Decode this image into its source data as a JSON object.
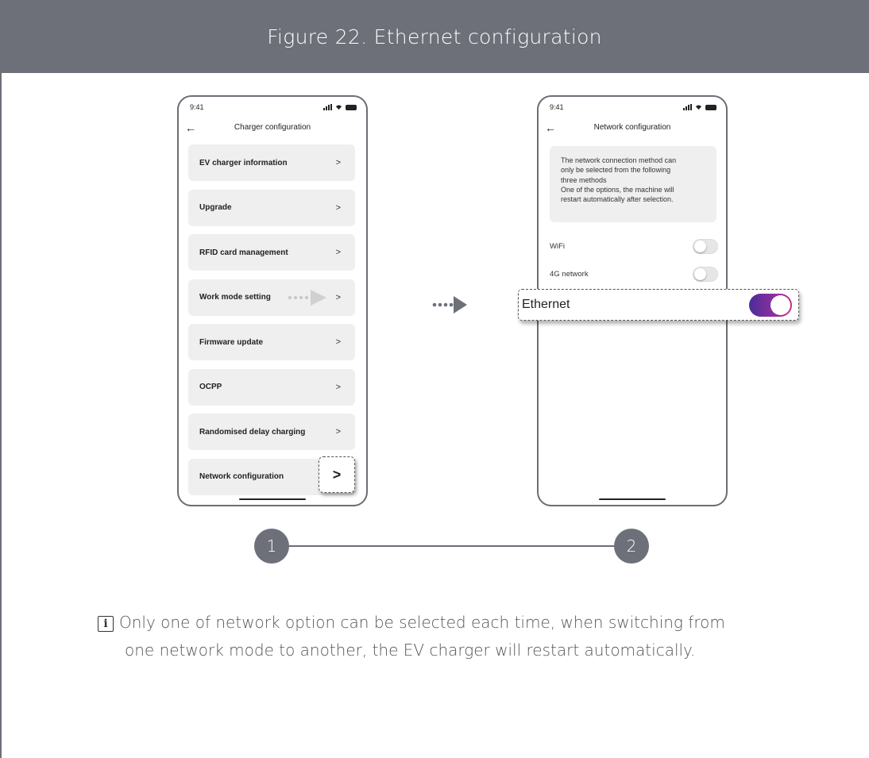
{
  "figure": {
    "title": "Figure 22.  Ethernet configuration"
  },
  "phone1": {
    "time": "9:41",
    "title": "Charger configuration",
    "menu": [
      "EV charger information",
      "Upgrade",
      "RFID card management",
      "Work mode setting",
      "Firmware update",
      "OCPP",
      "Randomised delay charging",
      "Network configuration"
    ],
    "chevron": ">"
  },
  "phone2": {
    "time": "9:41",
    "title": "Network configuration",
    "info": "The network connection method can\nonly be selected from the following\nthree methods\nOne of the options, the machine will\nrestart automatically after selection.",
    "options": [
      {
        "label": "WiFi",
        "enabled": false
      },
      {
        "label": "4G network",
        "enabled": false
      },
      {
        "label": "Ethernet",
        "enabled": true
      }
    ]
  },
  "steps": [
    "1",
    "2"
  ],
  "note": {
    "icon": "info-icon",
    "line1": "Only one of network option can be selected each time, when switching from",
    "line2": "one network mode to another, the EV charger will restart automatically."
  },
  "colors": {
    "header": "#6d7078",
    "toggle_on_start": "#4a2d99",
    "toggle_on_end": "#d12a8a",
    "arrow": "#6d7078"
  }
}
